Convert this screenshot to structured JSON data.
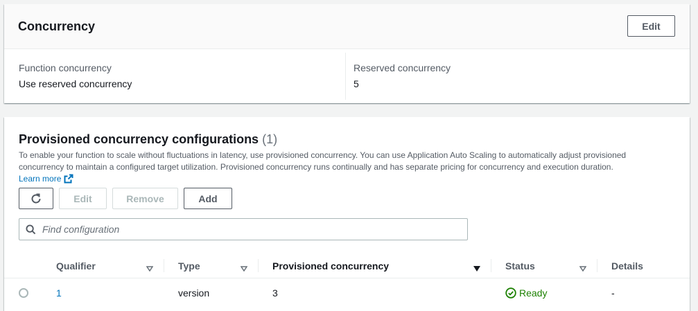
{
  "concurrency": {
    "title": "Concurrency",
    "edit_label": "Edit",
    "function_concurrency_label": "Function concurrency",
    "function_concurrency_value": "Use reserved concurrency",
    "reserved_concurrency_label": "Reserved concurrency",
    "reserved_concurrency_value": "5"
  },
  "provisioned": {
    "title": "Provisioned concurrency configurations",
    "count": "(1)",
    "description": "To enable your function to scale without fluctuations in latency, use provisioned concurrency. You can use Application Auto Scaling to automatically adjust provisioned concurrency to maintain a configured target utilization. Provisioned concurrency runs continually and has separate pricing for concurrency and execution duration.",
    "learn_more": "Learn more",
    "buttons": {
      "refresh_icon": "refresh-icon",
      "edit": "Edit",
      "remove": "Remove",
      "add": "Add"
    },
    "search": {
      "placeholder": "Find configuration",
      "value": ""
    },
    "table": {
      "columns": [
        "Qualifier",
        "Type",
        "Provisioned concurrency",
        "Status",
        "Details"
      ],
      "rows": [
        {
          "qualifier": "1",
          "type": "version",
          "provisioned_concurrency": "3",
          "status": "Ready",
          "details": "-"
        }
      ]
    }
  },
  "colors": {
    "link": "#0073bb",
    "success": "#1d8102",
    "border": "#545b64"
  }
}
